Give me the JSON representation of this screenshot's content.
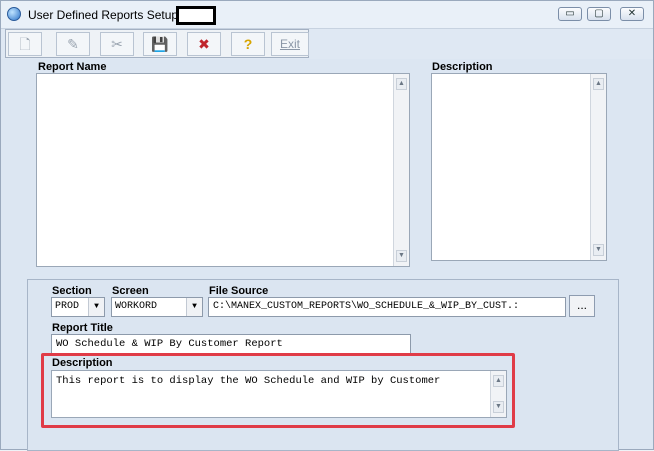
{
  "window": {
    "title": "User Defined Reports Setup",
    "controls": {
      "minimize": "▭",
      "maximize": "▢",
      "close": "✕"
    }
  },
  "toolbar": {
    "buttons": [
      {
        "icon": "new-page-icon",
        "glyph": "🗋"
      },
      {
        "icon": "edit-icon",
        "glyph": "✎"
      },
      {
        "icon": "cut-icon",
        "glyph": "✂"
      },
      {
        "icon": "save-icon",
        "glyph": "💾"
      },
      {
        "icon": "delete-icon",
        "glyph": "✖"
      },
      {
        "icon": "help-icon",
        "glyph": "?"
      },
      {
        "label": "Exit"
      }
    ]
  },
  "lists": {
    "report_name_label": "Report Name",
    "description_label": "Description",
    "scroll_up": "▲",
    "scroll_down": "▼"
  },
  "form": {
    "section_label": "Section",
    "section_value": "PROD",
    "screen_label": "Screen",
    "screen_value": "WORKORD",
    "file_source_label": "File Source",
    "file_source_value": "C:\\MANEX_CUSTOM_REPORTS\\WO_SCHEDULE_&_WIP_BY_CUST.:",
    "browse_label": "...",
    "report_title_label": "Report Title",
    "report_title_value": "WO Schedule & WIP By Customer Report",
    "description_label": "Description",
    "description_value": "This report is to display the WO Schedule and WIP by Customer",
    "dropdown_arrow": "▼"
  },
  "colors": {
    "highlight": "#e03b47"
  }
}
